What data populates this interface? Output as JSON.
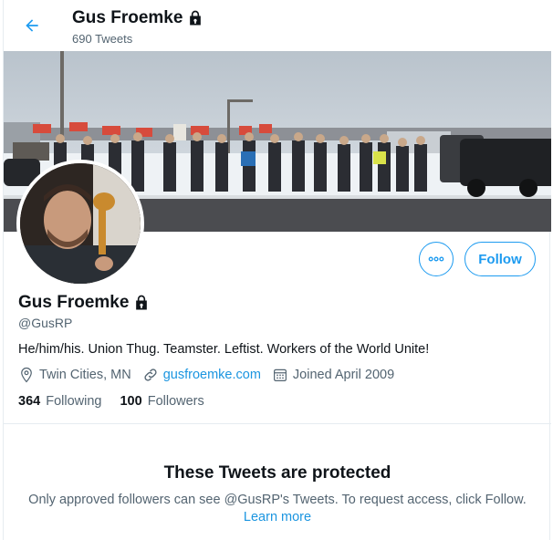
{
  "header": {
    "name": "Gus Froemke",
    "tweet_count": "690 Tweets"
  },
  "profile": {
    "name": "Gus Froemke",
    "handle": "@GusRP",
    "bio": "He/him/his. Union Thug. Teamster. Leftist. Workers of the World Unite!",
    "location": "Twin Cities, MN",
    "website": "gusfroemke.com",
    "joined": "Joined April 2009",
    "following_count": "364",
    "following_label": "Following",
    "followers_count": "100",
    "followers_label": "Followers",
    "protected": true
  },
  "buttons": {
    "follow_label": "Follow",
    "more_icon": "more-icon"
  },
  "protected_notice": {
    "title": "These Tweets are protected",
    "text": "Only approved followers can see @GusRP's Tweets. To request access, click Follow.",
    "link": "Learn more"
  },
  "colors": {
    "accent": "#1d9bf0",
    "link": "#1b95e0",
    "secondary_text": "#536471"
  }
}
